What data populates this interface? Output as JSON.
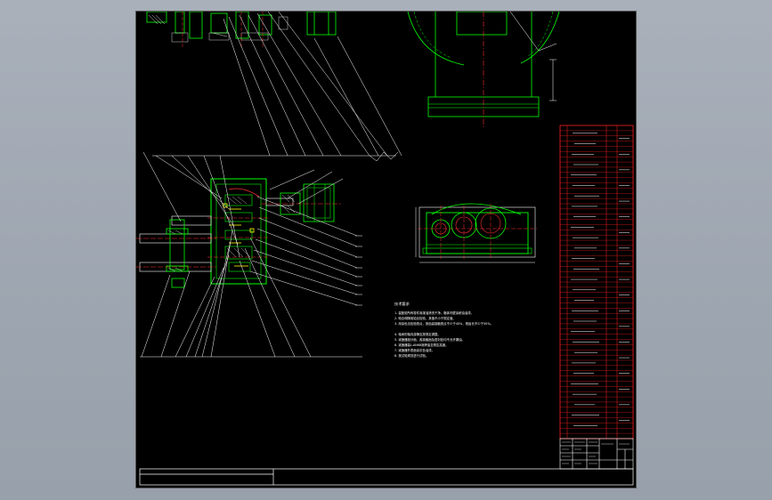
{
  "drawing": {
    "background": "#000000",
    "frame_color": "#ffffff",
    "part_color": "#00ff00",
    "centerline_color": "#ff3030",
    "hatch_color": "#ffffff",
    "table_line_color": "#ff2020"
  },
  "technical_requirements": {
    "title": "技术要求",
    "lines": [
      "1. 装配前所有零件用煤油清洗干净，箱体内壁涂耐油油漆。",
      "2. 啮合侧隙用铅丝检验，其值不小于规定值。",
      "3. 用涂色法检验斑点，按齿高接触斑点不少于40%，按齿长不少于50%。",
      "4. 轴承的轴向游隙应按规定调整。",
      "5. 减速器剖分面、各接触面及密封处均不允许漏油。",
      "6. 减速器装L-AN68润滑油至规定高度。",
      "7. 减速器外表面涂灰色油漆。",
      "8. 按试验规范进行试验。"
    ]
  },
  "parts_table": {
    "rows": 60
  }
}
